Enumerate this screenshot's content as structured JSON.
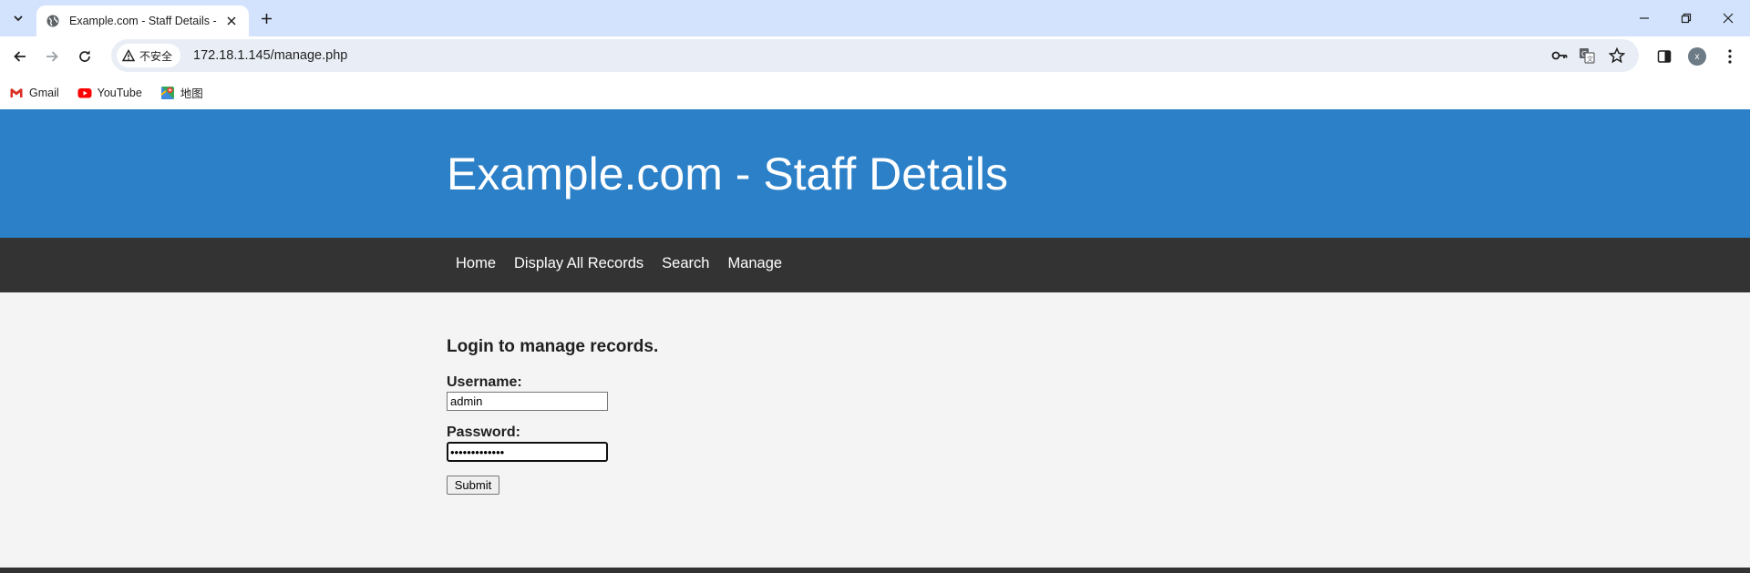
{
  "browser": {
    "tab_title": "Example.com - Staff Details -",
    "security_label": "不安全",
    "url": "172.18.1.145/manage.php",
    "profile_initial": "x",
    "bookmarks": [
      {
        "label": "Gmail",
        "icon": "gmail-icon"
      },
      {
        "label": "YouTube",
        "icon": "youtube-icon"
      },
      {
        "label": "地图",
        "icon": "maps-icon"
      }
    ]
  },
  "site": {
    "title": "Example.com - Staff Details",
    "nav": [
      {
        "label": "Home"
      },
      {
        "label": "Display All Records"
      },
      {
        "label": "Search"
      },
      {
        "label": "Manage"
      }
    ]
  },
  "login": {
    "heading": "Login to manage records.",
    "username_label": "Username:",
    "username_value": "admin",
    "password_label": "Password:",
    "password_value": "•••••••••••••",
    "submit_label": "Submit"
  },
  "colors": {
    "header_blue": "#2b80c8",
    "nav_dark": "#333333",
    "tabbar": "#d3e3fd",
    "page_bg": "#f4f4f4"
  }
}
